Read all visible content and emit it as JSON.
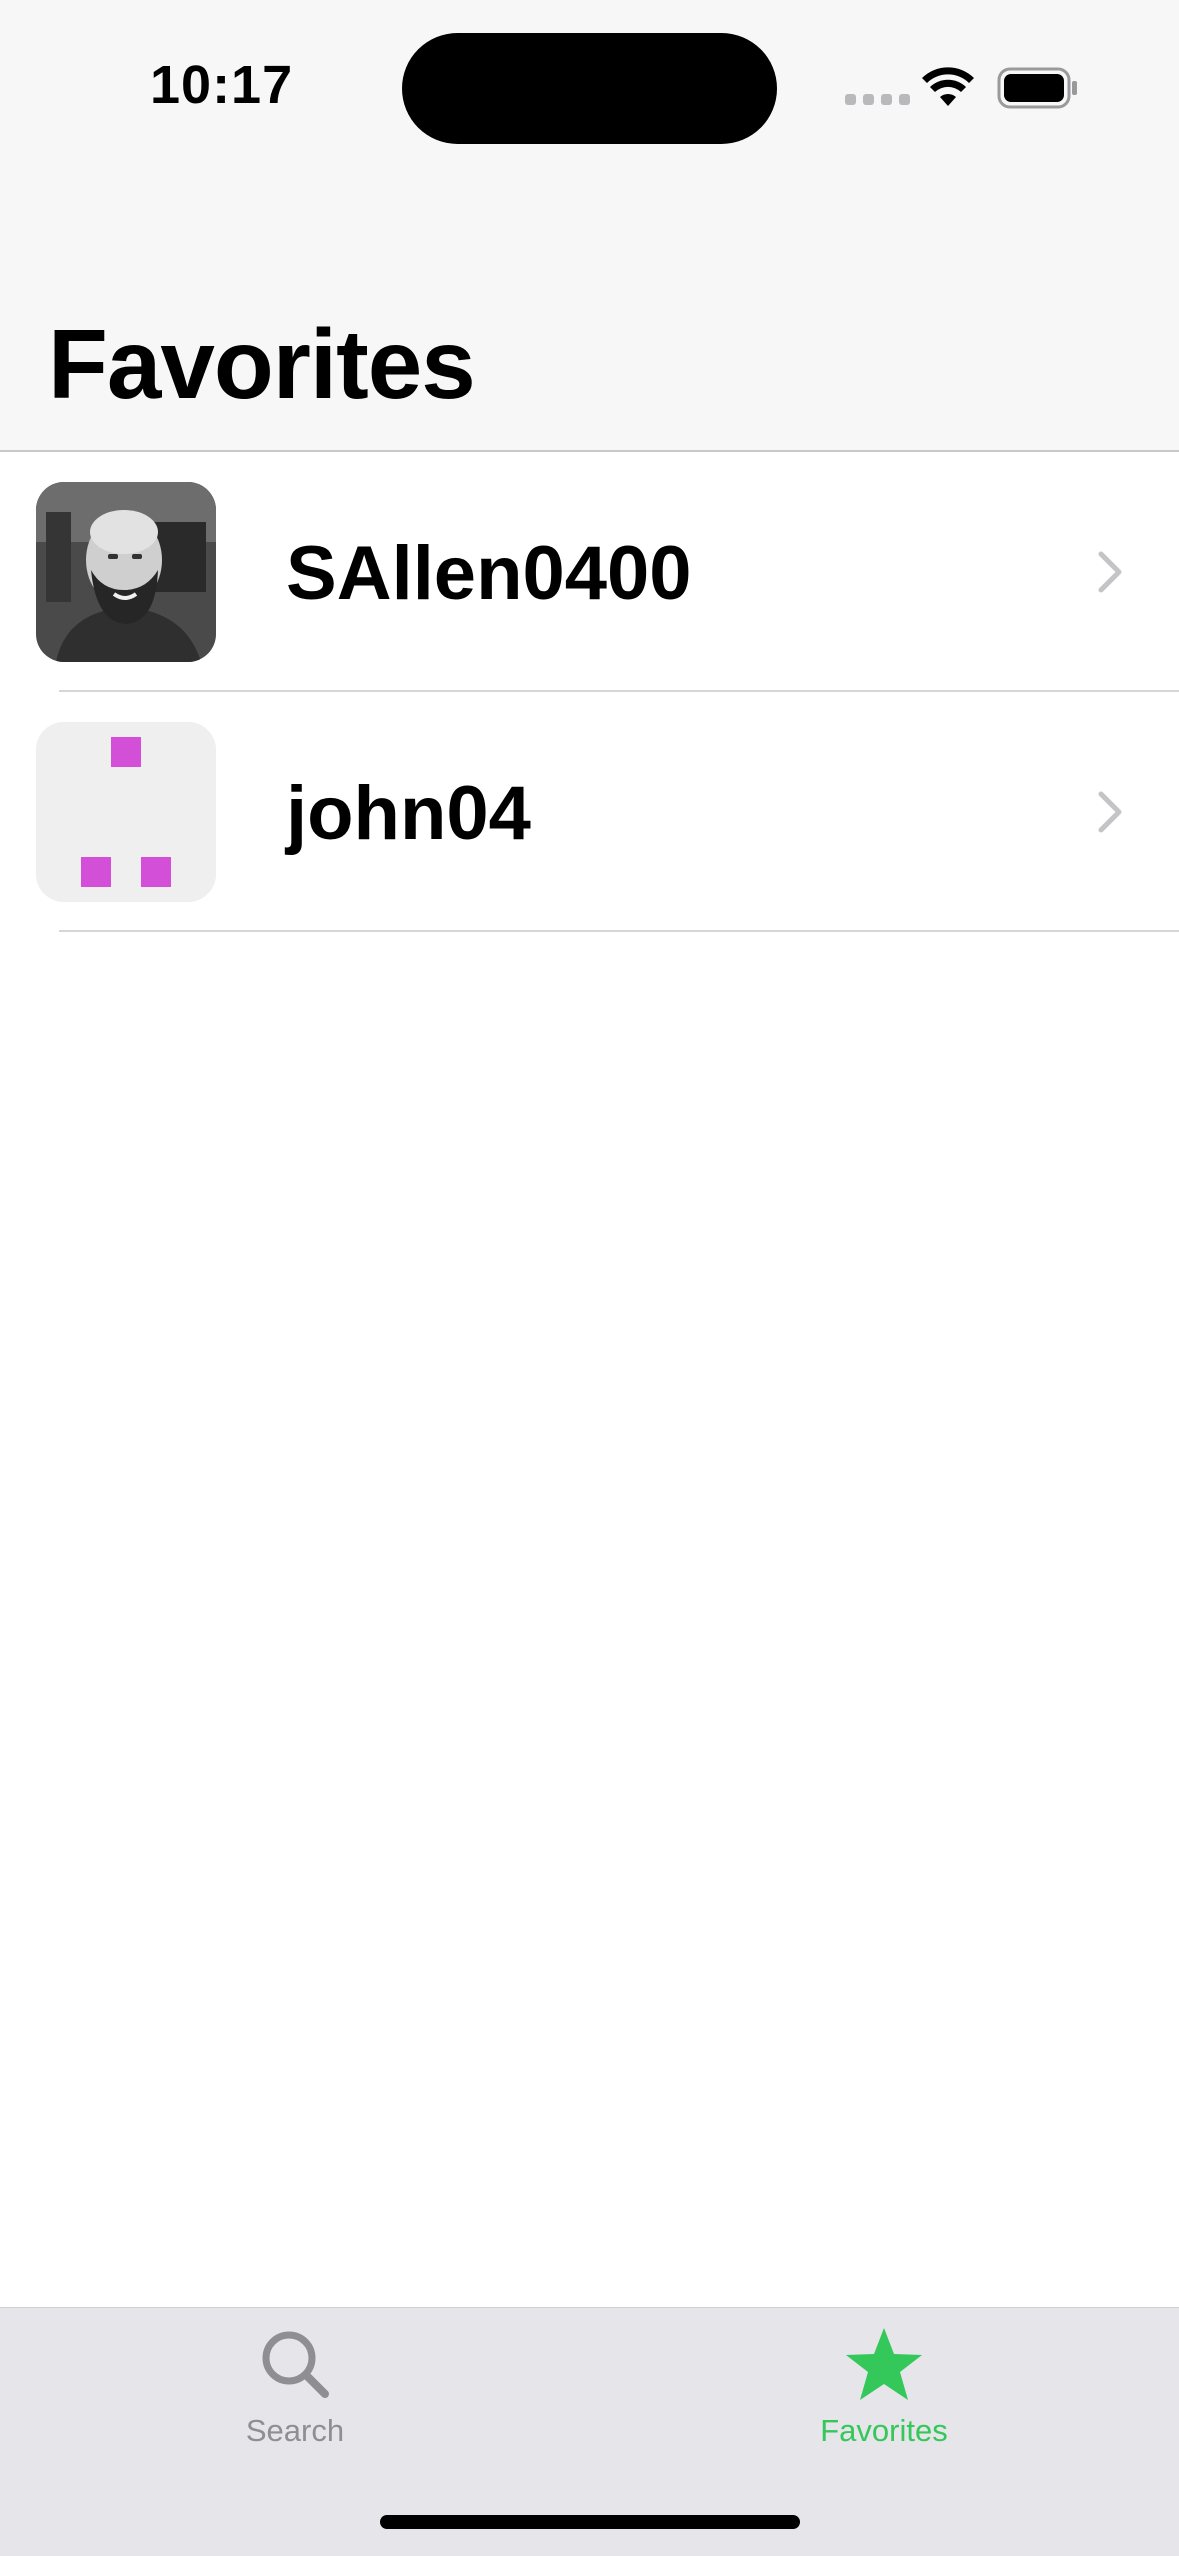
{
  "status_bar": {
    "time": "10:17"
  },
  "nav": {
    "title": "Favorites"
  },
  "favorites": [
    {
      "username": "SAllen0400",
      "avatar": "photo"
    },
    {
      "username": "john04",
      "avatar": "identicon"
    }
  ],
  "tabbar": {
    "tabs": [
      {
        "label": "Search",
        "icon": "magnifying-glass-icon",
        "selected": false
      },
      {
        "label": "Favorites",
        "icon": "star-icon",
        "selected": true
      }
    ]
  },
  "colors": {
    "accent": "#34c759",
    "inactive_tab": "#8e8e93",
    "identicon": "#d44fd8",
    "chevron": "#c4c4c7"
  }
}
